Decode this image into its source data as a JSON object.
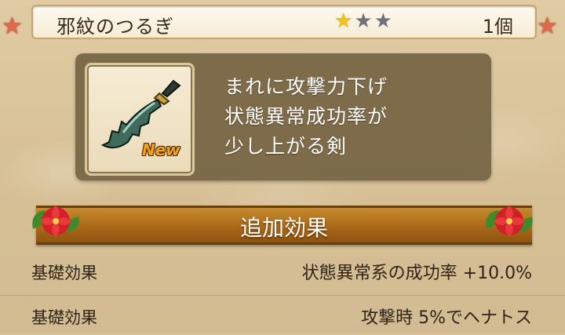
{
  "item": {
    "name": "邪紋のつるぎ",
    "stars_filled": 1,
    "stars_total": 3,
    "quantity": "1個",
    "new_badge": "New",
    "description_lines": [
      "まれに攻撃力下げ",
      "状態異常成功率が",
      "少し上がる剣"
    ]
  },
  "section": {
    "title": "追加効果"
  },
  "effects": [
    {
      "label": "基礎効果",
      "value": "状態異常系の成功率 +10.0%"
    },
    {
      "label": "基礎効果",
      "value": "攻撃時 5%でヘナトス"
    }
  ],
  "colors": {
    "star_on": "#f2c21e",
    "star_off": "#6f7278",
    "panel": "#705e3e",
    "banner": "#b0701e"
  }
}
